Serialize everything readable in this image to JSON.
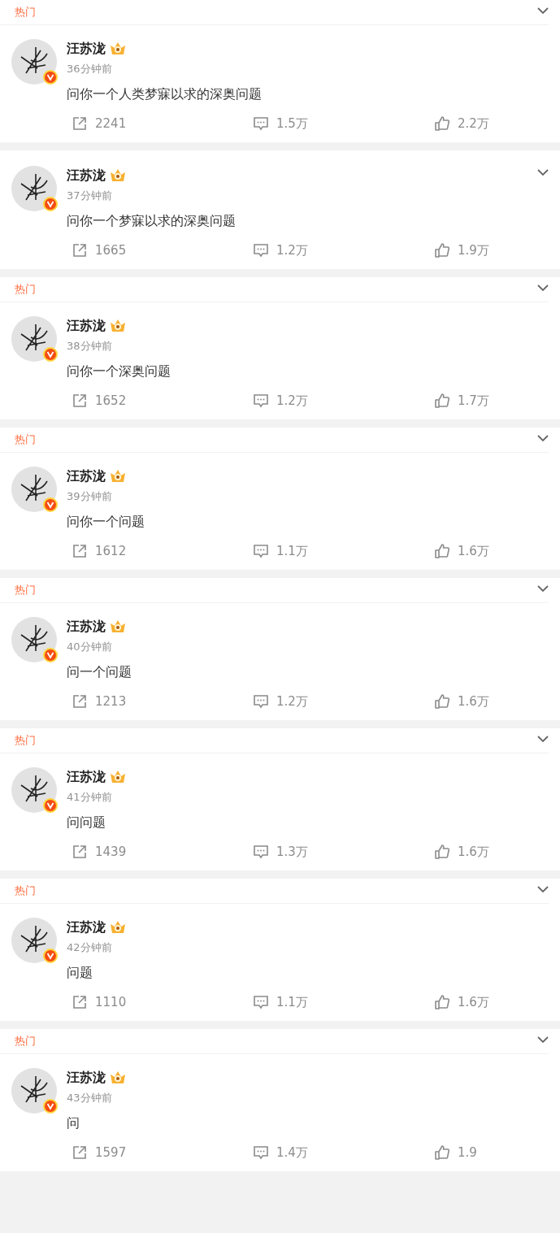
{
  "posts": [
    {
      "tag": "热门",
      "author": "汪苏泷",
      "verified": true,
      "time": "36分钟前",
      "text": "问你一个人类梦寐以求的深奥问题",
      "reposts": "2241",
      "comments": "1.5万",
      "likes": "2.2万"
    },
    {
      "author": "汪苏泷",
      "verified": true,
      "time": "37分钟前",
      "text": "问你一个梦寐以求的深奥问题",
      "reposts": "1665",
      "comments": "1.2万",
      "likes": "1.9万"
    },
    {
      "tag": "热门",
      "author": "汪苏泷",
      "verified": true,
      "time": "38分钟前",
      "text": "问你一个深奥问题",
      "reposts": "1652",
      "comments": "1.2万",
      "likes": "1.7万"
    },
    {
      "tag": "热门",
      "author": "汪苏泷",
      "verified": true,
      "time": "39分钟前",
      "text": "问你一个问题",
      "reposts": "1612",
      "comments": "1.1万",
      "likes": "1.6万"
    },
    {
      "tag": "热门",
      "author": "汪苏泷",
      "verified": true,
      "time": "40分钟前",
      "text": "问一个问题",
      "reposts": "1213",
      "comments": "1.2万",
      "likes": "1.6万"
    },
    {
      "tag": "热门",
      "author": "汪苏泷",
      "verified": true,
      "time": "41分钟前",
      "text": "问问题",
      "reposts": "1439",
      "comments": "1.3万",
      "likes": "1.6万"
    },
    {
      "tag": "热门",
      "author": "汪苏泷",
      "verified": true,
      "time": "42分钟前",
      "text": "问题",
      "reposts": "1110",
      "comments": "1.1万",
      "likes": "1.6万"
    },
    {
      "tag": "热门",
      "author": "汪苏泷",
      "verified": true,
      "time": "43分钟前",
      "text": "问",
      "reposts": "1597",
      "comments": "1.4万",
      "likes": "1.9"
    }
  ]
}
